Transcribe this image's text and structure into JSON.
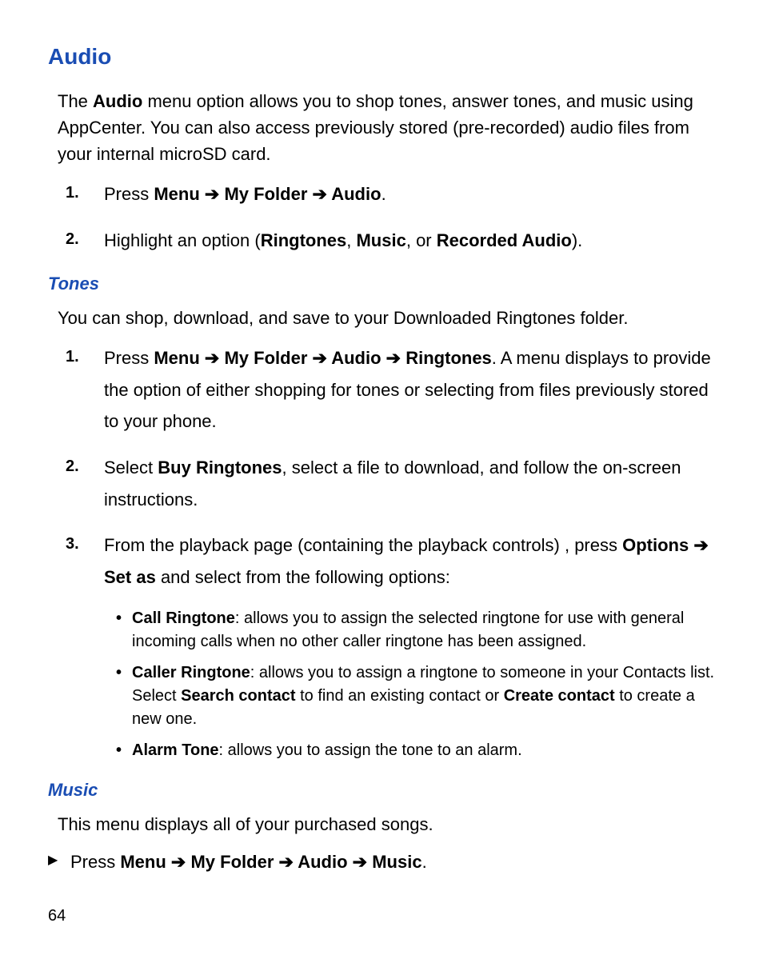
{
  "section_title": "Audio",
  "intro": {
    "pre": "The ",
    "bold": "Audio",
    "post": " menu option allows you to shop tones, answer tones, and music using AppCenter. You can also access previously stored (pre-recorded) audio files from your internal microSD card."
  },
  "step1": {
    "num": "1.",
    "press": "Press ",
    "menu": "Menu",
    "arrow1": " ➔ ",
    "folder": "My Folder",
    "arrow2": " ➔ ",
    "audio": "Audio",
    "dot": "."
  },
  "step2": {
    "num": "2.",
    "txt": "Highlight an option (",
    "ring": "Ringtones",
    "c1": ", ",
    "music": "Music",
    "c2": ", or ",
    "rec": "Recorded Audio",
    "end": ")."
  },
  "tones_title": "Tones",
  "tones_intro": "You can shop, download, and save to your Downloaded Ringtones folder.",
  "tstep1": {
    "num": "1.",
    "press": "Press ",
    "menu": "Menu",
    "a1": " ➔ ",
    "folder": "My Folder",
    "a2": " ➔ ",
    "audio": "Audio",
    "a3": " ➔ ",
    "ring": "Ringtones",
    "rest": ". A menu displays to provide the option of either shopping for tones or selecting from files previously stored to your phone."
  },
  "tstep2": {
    "num": "2.",
    "pre": "Select ",
    "buy": "Buy Ringtones",
    "post": ", select a file to download, and follow the on-screen instructions."
  },
  "tstep3": {
    "num": "3.",
    "pre": "From the playback page (containing the playback controls) , press ",
    "opt": "Options",
    "a": " ➔ ",
    "setas": "Set as",
    "post": " and select from the following options:"
  },
  "bullet1": {
    "label": "Call Ringtone",
    "txt": ": allows you to assign the selected ringtone for use with general incoming calls when no other caller ringtone has been assigned."
  },
  "bullet2": {
    "label": "Caller Ringtone",
    "pre": ": allows you to assign a ringtone to someone in your Contacts list. Select ",
    "search": "Search contact",
    "mid": " to find an existing contact or ",
    "create": "Create contact",
    "post": " to create a new one."
  },
  "bullet3": {
    "label": "Alarm Tone",
    "txt": ": allows you to assign the tone to an alarm."
  },
  "music_title": "Music",
  "music_intro": "This menu displays all of your purchased songs.",
  "music_step": {
    "press": "Press ",
    "menu": "Menu",
    "a1": " ➔ ",
    "folder": "My Folder",
    "a2": " ➔ ",
    "audio": "Audio",
    "a3": " ➔ ",
    "music": "Music",
    "dot": "."
  },
  "page_number": "64"
}
